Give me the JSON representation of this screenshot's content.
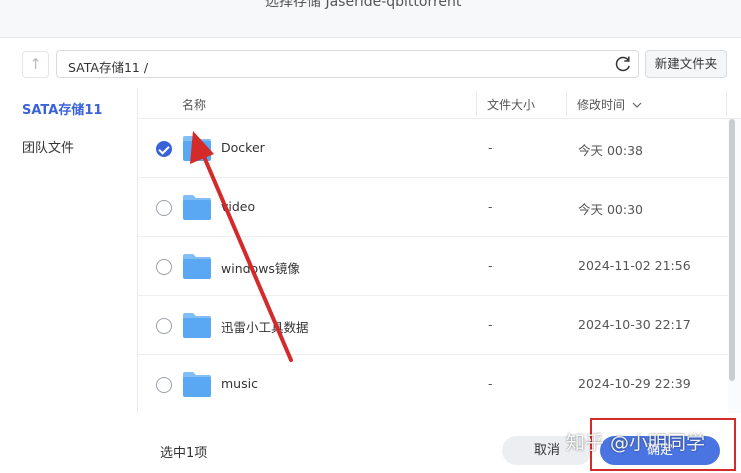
{
  "window": {
    "title": "选择存储 Jaseride-qbittorrent"
  },
  "toolbar": {
    "up_icon": "up-arrow-icon",
    "path": "SATA存储11 /",
    "refresh_icon": "refresh-icon",
    "new_folder_label": "新建文件夹"
  },
  "sidebar": {
    "items": [
      {
        "label": "SATA存储11",
        "active": true
      },
      {
        "label": "团队文件",
        "active": false
      }
    ]
  },
  "table": {
    "headers": {
      "name": "名称",
      "size": "文件大小",
      "modified": "修改时间"
    },
    "sort_icon": "chevron-down-icon",
    "rows": [
      {
        "name": "Docker",
        "size": "-",
        "modified": "今天 00:38",
        "selected": true
      },
      {
        "name": "video",
        "size": "-",
        "modified": "今天 00:30",
        "selected": false
      },
      {
        "name": "windows镜像",
        "size": "-",
        "modified": "2024-11-02 21:56",
        "selected": false
      },
      {
        "name": "迅雷小工具数据",
        "size": "-",
        "modified": "2024-10-30 22:17",
        "selected": false
      },
      {
        "name": "music",
        "size": "-",
        "modified": "2024-10-29 22:39",
        "selected": false
      }
    ]
  },
  "footer": {
    "selected_count": "选中1项",
    "cancel_label": "取消",
    "ok_label": "确定"
  },
  "overlay": {
    "watermark": "知乎 @小明同学",
    "arrow_color": "#d42a2a",
    "highlight_color": "#d42a2a"
  },
  "colors": {
    "accent": "#3a63d8",
    "folder": "#5aa7f3",
    "primary_button": "#4a74e2"
  }
}
